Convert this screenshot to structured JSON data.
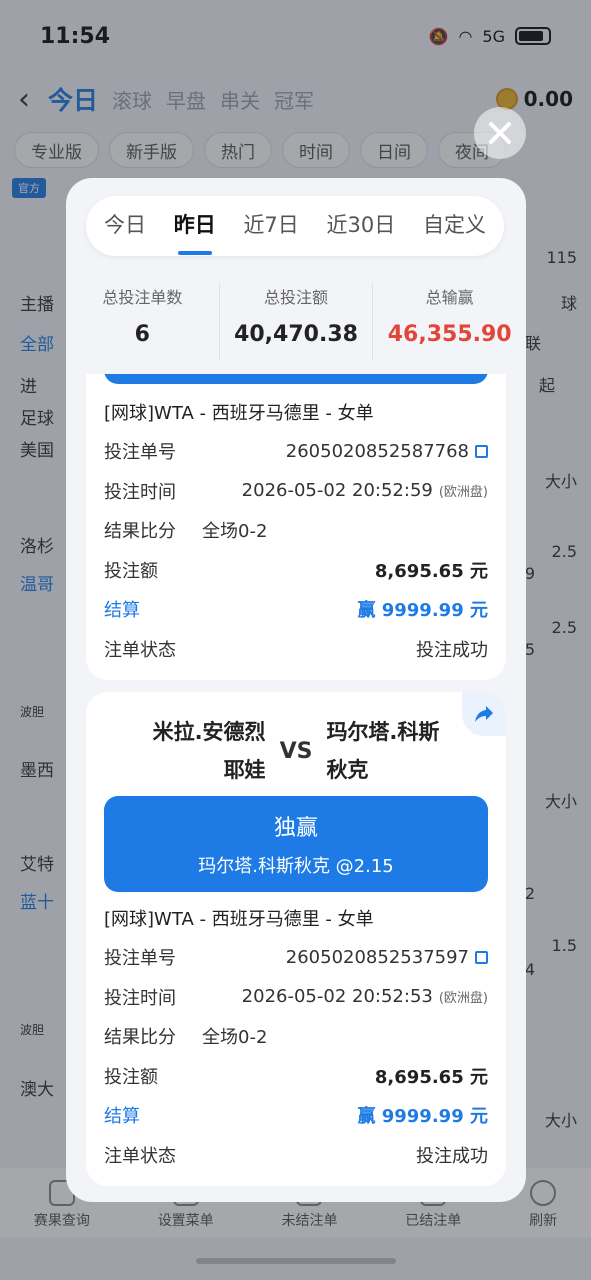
{
  "status_bar": {
    "time": "11:54",
    "signal": "5G"
  },
  "nav": {
    "tabs": [
      "今日",
      "滚球",
      "早盘",
      "串关",
      "冠军"
    ],
    "active_tab": "今日",
    "balance": "0.00"
  },
  "filters": [
    "专业版",
    "新手版",
    "热门",
    "时间",
    "日间",
    "夜间"
  ],
  "background": {
    "badge": "官方",
    "left_items": [
      "主播",
      "全部",
      "进",
      "足球",
      "美国",
      "洛杉",
      "温哥",
      "波胆",
      "墨西",
      "艾特",
      "蓝十",
      "波胆",
      "澳大"
    ],
    "right_items": [
      "115",
      "球",
      "联",
      "起",
      "大小",
      "2.5",
      "9",
      "2.5",
      "5",
      "大小",
      "2",
      "1.5",
      "4",
      "大小"
    ]
  },
  "bottom_nav": [
    "赛果查询",
    "设置菜单",
    "未结注单",
    "已结注单",
    "刷新"
  ],
  "modal": {
    "date_tabs": [
      "今日",
      "昨日",
      "近7日",
      "近30日",
      "自定义"
    ],
    "active_date_tab": "昨日",
    "summary": {
      "count_label": "总投注单数",
      "count_value": "6",
      "amount_label": "总投注额",
      "amount_value": "40,470.38",
      "winloss_label": "总输赢",
      "winloss_value": "46,355.90"
    },
    "labels": {
      "order_no": "投注单号",
      "bet_time": "投注时间",
      "score": "结果比分",
      "stake": "投注额",
      "settle": "结算",
      "status": "注单状态"
    },
    "bets": [
      {
        "league": "[网球]WTA - 西班牙马德里 - 女单",
        "order_no": "2605020852587768",
        "bet_time": "2026-05-02 20:52:59",
        "market_tag": "(欧洲盘)",
        "score": "全场0-2",
        "stake": "8,695.65 元",
        "settle": "赢 9999.99 元",
        "status": "投注成功"
      },
      {
        "home": "米拉.安德烈耶娃",
        "home_line1": "米拉.安德烈",
        "home_line2": "耶娃",
        "vs": "VS",
        "away": "玛尔塔.科斯秋克",
        "away_line1": "玛尔塔.科斯",
        "away_line2": "秋克",
        "bet_type": "独赢",
        "pick": "玛尔塔.科斯秋克 @2.15",
        "league": "[网球]WTA - 西班牙马德里 - 女单",
        "order_no": "2605020852537597",
        "bet_time": "2026-05-02 20:52:53",
        "market_tag": "(欧洲盘)",
        "score": "全场0-2",
        "stake": "8,695.65 元",
        "settle": "赢 9999.99 元",
        "status": "投注成功"
      }
    ]
  },
  "colors": {
    "accent": "#1e7be6",
    "loss_red": "#e2463a"
  }
}
